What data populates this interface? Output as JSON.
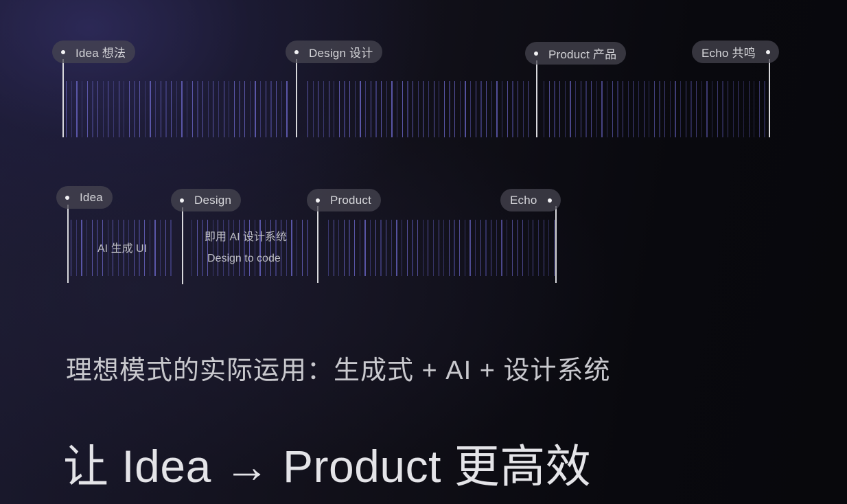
{
  "timeline_top": {
    "stages": [
      {
        "label": "Idea 想法",
        "dot_side": "left"
      },
      {
        "label": "Design 设计",
        "dot_side": "left"
      },
      {
        "label": "Product 产品",
        "dot_side": "left"
      },
      {
        "label": "Echo 共鸣",
        "dot_side": "right"
      }
    ]
  },
  "timeline_bottom": {
    "stages": [
      {
        "label": "Idea",
        "dot_side": "left"
      },
      {
        "label": "Design",
        "dot_side": "left"
      },
      {
        "label": "Product",
        "dot_side": "left"
      },
      {
        "label": "Echo",
        "dot_side": "right"
      }
    ],
    "segment_labels": {
      "idea_to_design": "AI 生成 UI",
      "design_to_product_line1": "即用 AI 设计系统",
      "design_to_product_line2": "Design to code"
    }
  },
  "subtitle": "理想模式的实际运用：生成式 + AI + 设计系统",
  "headline": "让 Idea → Product 更高效",
  "colors": {
    "tick_bright": "#5a56a8",
    "tick_dim": "#3a3870",
    "marker": "#d8d8dc",
    "pill_bg": "#484752"
  }
}
